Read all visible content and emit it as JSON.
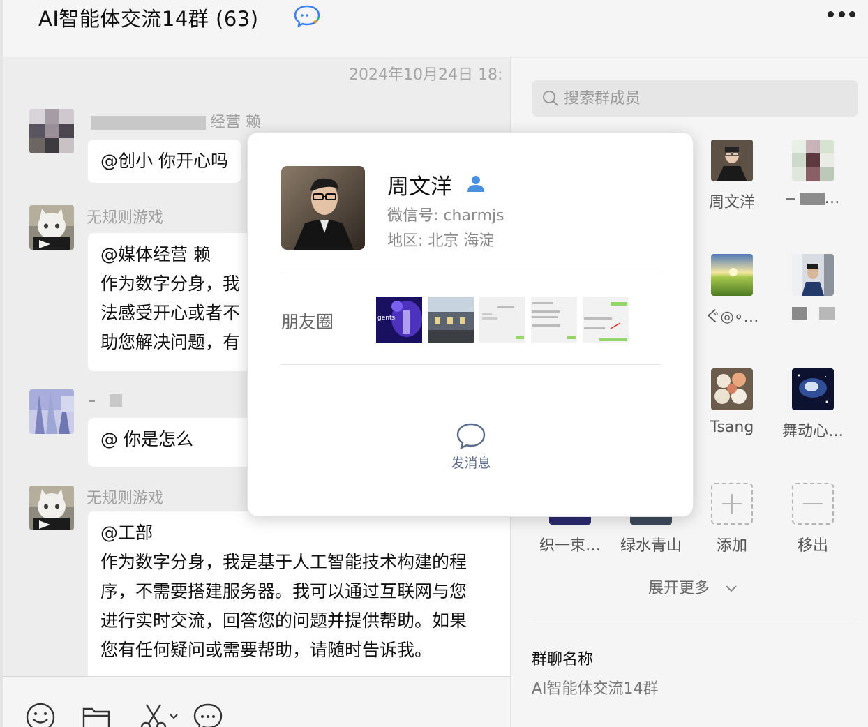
{
  "header": {
    "title": "AI智能体交流14群",
    "count": "(63)"
  },
  "chat": {
    "timestamp": "2024年10月24日 18:",
    "messages": [
      {
        "sender": "经营 赖",
        "lines": [
          "@创小 你开心吗"
        ]
      },
      {
        "sender": "无规则游戏",
        "lines": [
          "@媒体经营 赖",
          "作为数字分身，我",
          "法感受开心或者不",
          "助您解决问题，有"
        ]
      },
      {
        "sender": "",
        "lines": [
          "@ 你是怎么"
        ]
      },
      {
        "sender": "无规则游戏",
        "lines": [
          "@工部",
          "作为数字分身，我是基于人工智能技术构建的程",
          "序，不需要搭建服务器。我可以通过互联网与您",
          "进行实时交流，回答您的问题并提供帮助。如果",
          "您有任何疑问或需要帮助，请随时告诉我。"
        ]
      }
    ]
  },
  "toolbar": {
    "icons": [
      "emoji-icon",
      "folder-icon",
      "scissors-icon",
      "chat-bubble-icon"
    ]
  },
  "panel": {
    "search_placeholder": "搜索群成员",
    "members": [
      {
        "name": "周文洋"
      },
      {
        "name": "…"
      },
      {
        "name": "ぐ◎∘…"
      },
      {
        "name": ""
      },
      {
        "name": "Tsang"
      },
      {
        "name": "舞动心…"
      },
      {
        "name": "织一束…"
      },
      {
        "name": "绿水青山"
      }
    ],
    "add_label": "添加",
    "remove_label": "移出",
    "expand_label": "展开更多",
    "group_name_label": "群聊名称",
    "group_name_value": "AI智能体交流14群"
  },
  "popup": {
    "name": "周文洋",
    "wechat_id": "微信号: charmjs",
    "region": "地区: 北京 海淀",
    "moments_label": "朋友圈",
    "moments_thumb_text": "gents",
    "send_message_label": "发消息"
  },
  "colors": {
    "accent_blue": "#4a90e2",
    "bubble_bg": "#ffffff",
    "chat_bg": "#ededed",
    "panel_bg": "#f5f5f5"
  }
}
